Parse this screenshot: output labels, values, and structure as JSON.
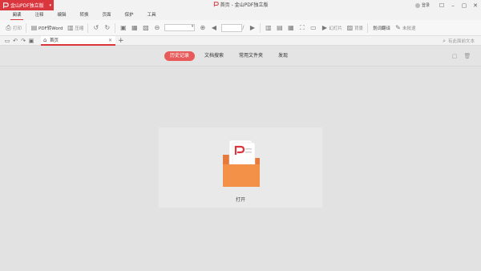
{
  "app": {
    "name": "金山PDF独立版",
    "window_title": "首页 - 金山PDF独立版",
    "brand_color": "#d9363e"
  },
  "user": {
    "login_label": "登录"
  },
  "menu": {
    "items": [
      "阅读",
      "注释",
      "编辑",
      "转换",
      "页面",
      "保护",
      "工具"
    ],
    "active_index": 0
  },
  "toolbar": {
    "print": "打印",
    "pdf_to_word": "PDF转Word",
    "compress": "压缩",
    "page_separator": "/",
    "slideshow": "幻灯片",
    "background": "背景",
    "translate": "划词翻译",
    "edit_off": "未批退"
  },
  "tabs": {
    "home_label": "首页",
    "search_placeholder": "有此面前文本"
  },
  "home": {
    "tabs": [
      "历史记录",
      "文档搜索",
      "常用文件夹",
      "发现"
    ],
    "active_tab": 0,
    "open_label": "打开"
  }
}
